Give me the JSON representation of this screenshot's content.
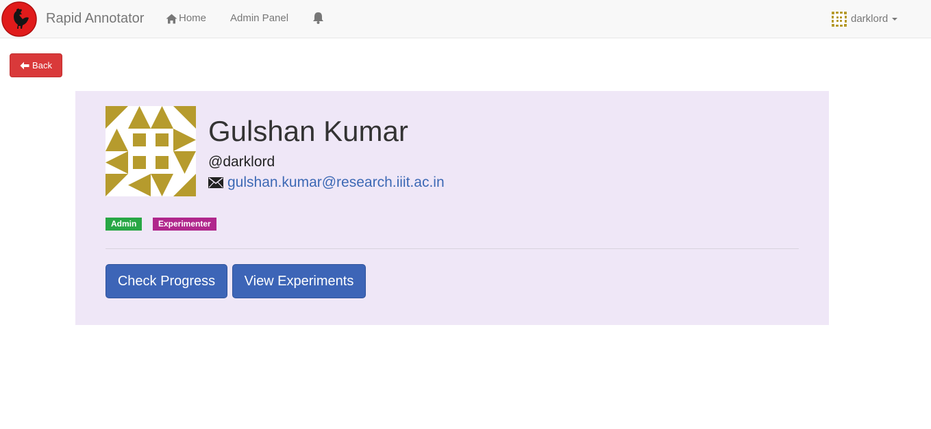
{
  "navbar": {
    "brand": "Rapid Annotator",
    "home_label": "Home",
    "admin_label": "Admin Panel",
    "user_label": "darklord"
  },
  "back_button": {
    "label": "Back"
  },
  "profile": {
    "full_name": "Gulshan Kumar",
    "username": "@darklord",
    "email": "gulshan.kumar@research.iiit.ac.in",
    "roles": [
      "Admin",
      "Experimenter"
    ]
  },
  "actions": {
    "check_progress": "Check Progress",
    "view_experiments": "View Experiments"
  },
  "icons": {
    "logo": "rooster-logo-icon",
    "home": "home-icon",
    "bell": "bell-icon",
    "back": "arrow-left-icon",
    "email": "envelope-icon",
    "avatar": "identicon-avatar-icon",
    "caret": "caret-down-icon"
  },
  "colors": {
    "navbar_bg": "#f8f8f8",
    "danger": "#d9393a",
    "card_bg": "#efe7f7",
    "identicon": "#b69b2d",
    "admin_badge": "#28a745",
    "experimenter_badge": "#b0278c",
    "primary": "#3d65b7",
    "link": "#3d69b5"
  }
}
